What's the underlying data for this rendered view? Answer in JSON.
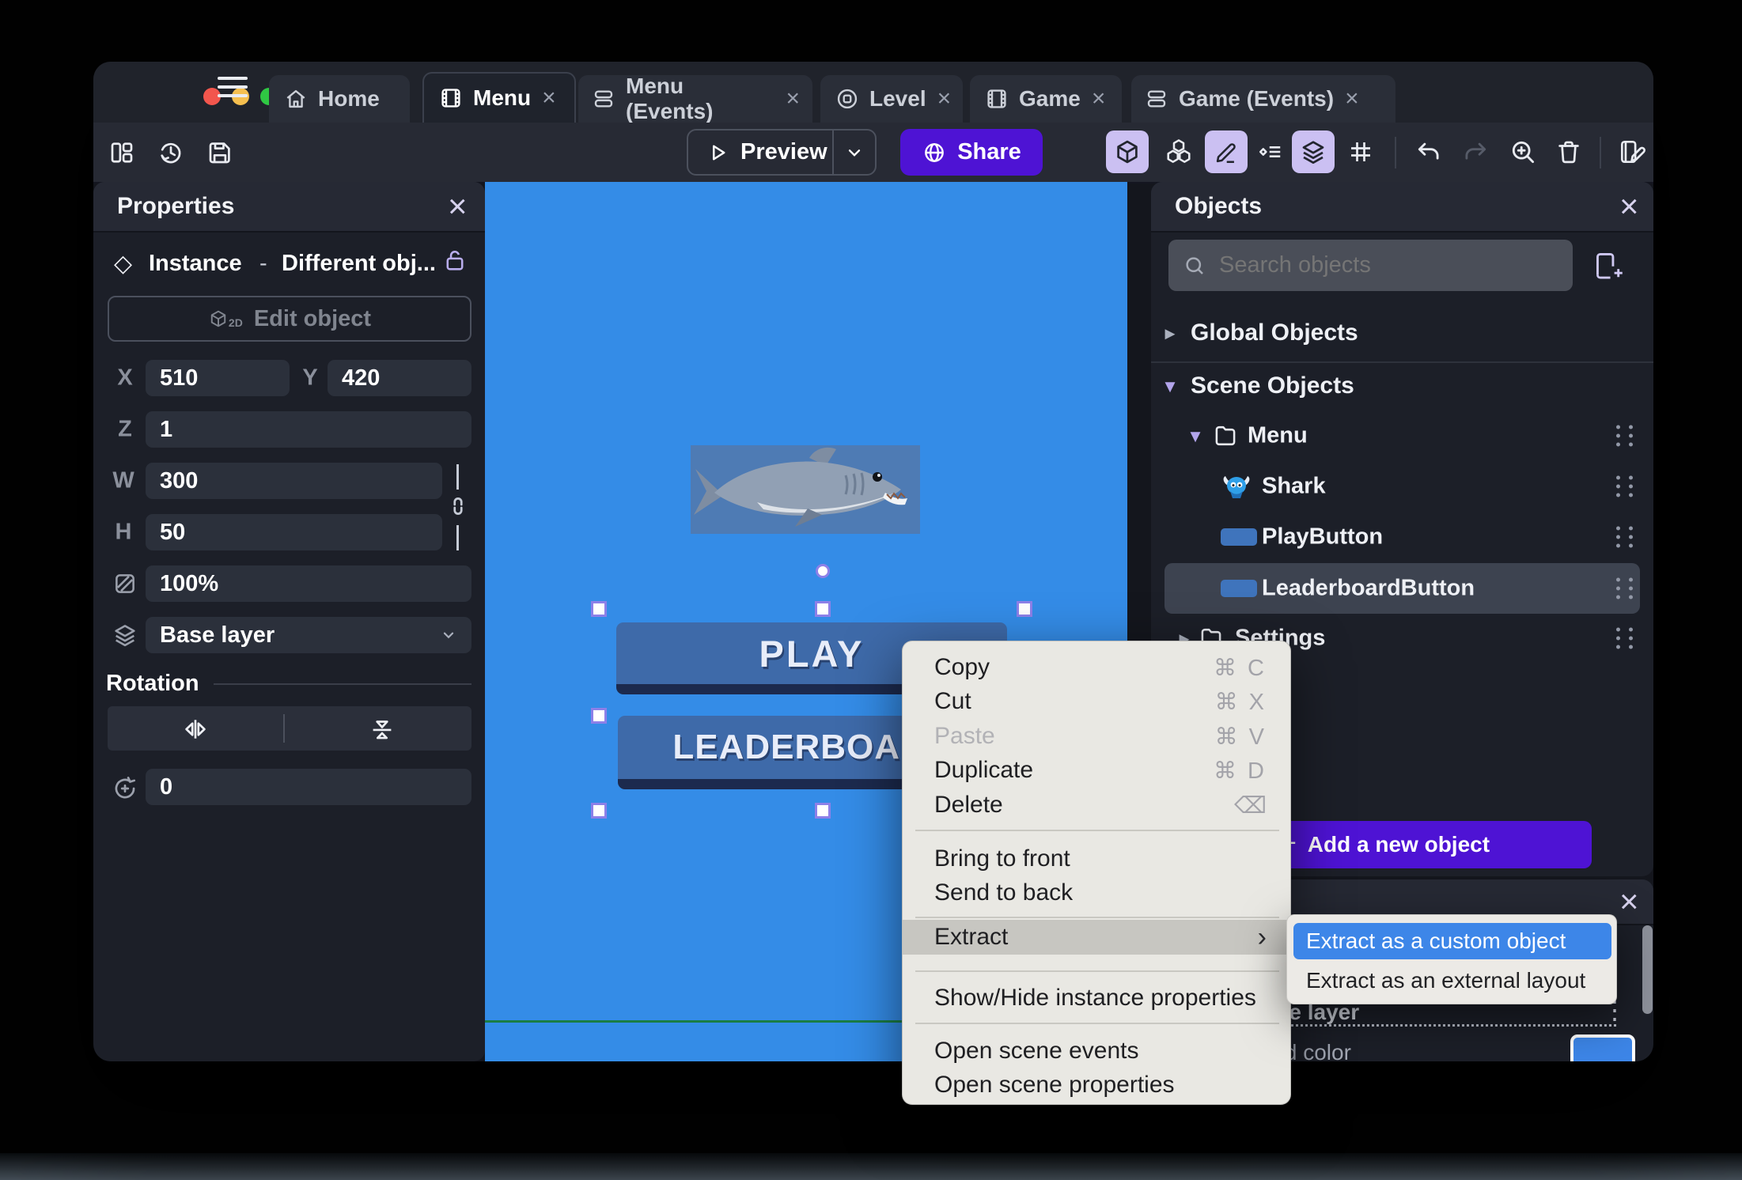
{
  "titlebar": {
    "tabs": [
      {
        "label": "Home",
        "icon": "home-icon",
        "closable": false
      },
      {
        "label": "Menu",
        "icon": "scene-icon",
        "closable": true,
        "active": true
      },
      {
        "label": "Menu (Events)",
        "icon": "events-icon",
        "closable": true
      },
      {
        "label": "Level",
        "icon": "level-icon",
        "closable": true
      },
      {
        "label": "Game",
        "icon": "scene-icon",
        "closable": true
      },
      {
        "label": "Game (Events)",
        "icon": "events-icon",
        "closable": true
      }
    ],
    "tab_close_symbol": "×"
  },
  "toolbar": {
    "preview_label": "Preview",
    "share_label": "Share"
  },
  "properties": {
    "title": "Properties",
    "close_symbol": "×",
    "instance_title": "Instance",
    "instance_dash": "-",
    "instance_subtitle": "Different obj...",
    "edit_object_label": "Edit object",
    "edit_object_badge": "2D",
    "x_label": "X",
    "x_value": "510",
    "y_label": "Y",
    "y_value": "420",
    "z_label": "Z",
    "z_value": "1",
    "w_label": "W",
    "w_value": "300",
    "h_label": "H",
    "h_value": "50",
    "opacity_value": "100%",
    "layer_value": "Base layer",
    "rotation_title": "Rotation",
    "rotation_value": "0"
  },
  "canvas": {
    "background_color": "#348ce7",
    "play_label": "PLAY",
    "leaderboard_label": "LEADERBOARD"
  },
  "objects": {
    "title": "Objects",
    "close_symbol": "×",
    "search_placeholder": "Search objects",
    "global_group_label": "Global Objects",
    "scene_group_label": "Scene Objects",
    "folder_menu_label": "Menu",
    "item_shark_label": "Shark",
    "item_play_label": "PlayButton",
    "item_leaderboard_label": "LeaderboardButton",
    "folder_settings_label": "Settings",
    "add_button_plus": "+",
    "add_button_label": "Add a new object"
  },
  "layers": {
    "close_symbol": "×",
    "base_layer_label": "Base layer",
    "background_color_label": "Background color",
    "row_menu_symbol": "⋮",
    "swatch_color": "#3d86e8"
  },
  "context_menu": {
    "items": [
      {
        "label": "Copy",
        "shortcut": "⌘ C"
      },
      {
        "label": "Cut",
        "shortcut": "⌘ X"
      },
      {
        "label": "Paste",
        "shortcut": "⌘ V",
        "disabled": true
      },
      {
        "label": "Duplicate",
        "shortcut": "⌘ D"
      },
      {
        "label": "Delete",
        "shortcut": "⌫"
      },
      {
        "label": "Bring to front",
        "shortcut": ""
      },
      {
        "label": "Send to back",
        "shortcut": ""
      },
      {
        "label": "Extract",
        "shortcut": "›",
        "submenu_open": true
      },
      {
        "label": "Show/Hide instance properties",
        "shortcut": ""
      },
      {
        "label": "Open scene events",
        "shortcut": ""
      },
      {
        "label": "Open scene properties",
        "shortcut": ""
      }
    ]
  },
  "submenu": {
    "items": [
      {
        "label": "Extract as a custom object",
        "highlighted": true
      },
      {
        "label": "Extract as an external layout",
        "highlighted": false
      }
    ]
  },
  "colors": {
    "accent_purple": "#4e13d4",
    "accent_lavender": "#cbc0f2",
    "canvas_blue": "#348ce7",
    "game_button_blue": "#3e6aa9",
    "selection_blue": "#3d86e8",
    "panel_bg": "#1c1f28",
    "header_bg": "#262934",
    "traffic_red": "#f2564d",
    "traffic_yellow": "#f5bf4f",
    "traffic_green": "#2fc843"
  }
}
